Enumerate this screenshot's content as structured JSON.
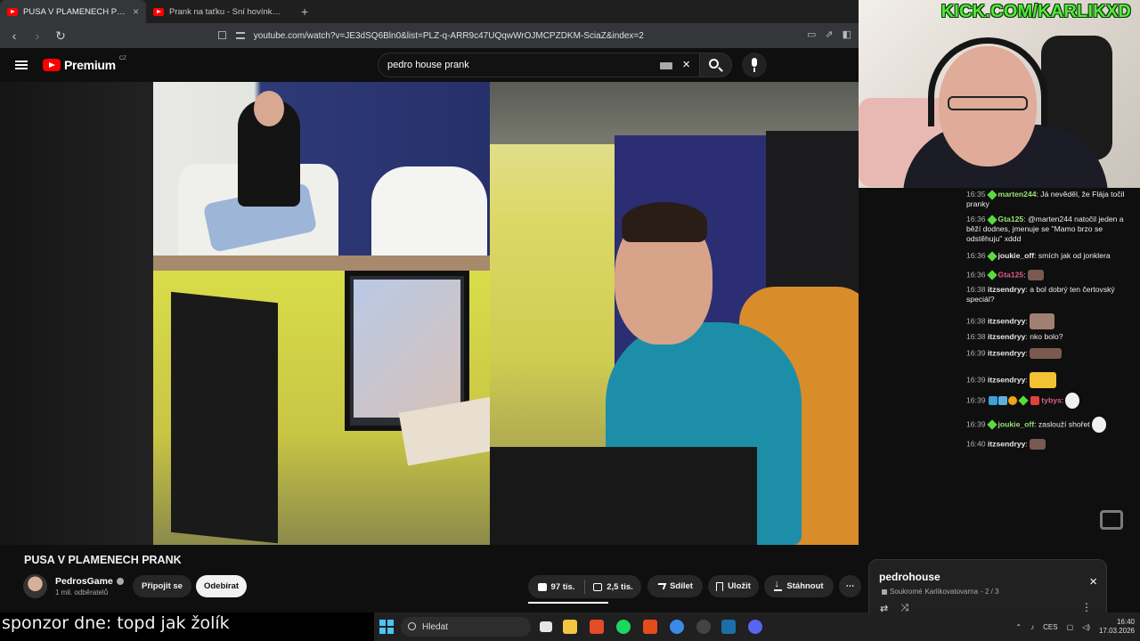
{
  "browser": {
    "tabs": [
      {
        "label": "PUSA V PLAMENECH PRANK",
        "close": "×"
      },
      {
        "label": "Prank na taťku - Sní hovínko!! - YouT",
        "close": ""
      }
    ],
    "new_tab": "+",
    "url": "youtube.com/watch?v=JE3dSQ6Bln0&list=PLZ-q-ARR9c47UQqwWrOJMCPZDKM-SciaZ&index=2"
  },
  "youtube": {
    "logo": "Premium",
    "region": "CZ",
    "search_value": "pedro house prank",
    "clear": "×"
  },
  "stream": {
    "kick_url": "KICK.COM/KARLIKXD",
    "sponsor": "sponzor dne: topd jak žolík"
  },
  "chat": [
    {
      "time": "16:35",
      "nick": "marten244",
      "text": ": Já nevěděl, že Flája točil pranky"
    },
    {
      "time": "16:36",
      "nick": "Gta125",
      "text": ": @marten244 natočil jeden a běží dodnes, jmenuje se \"Mamo brzo se odstěhuju\" xddd"
    },
    {
      "time": "16:36",
      "nick": "joukie_off",
      "text": ": smích jak od jonklera"
    },
    {
      "time": "16:36",
      "nick": "Gta125",
      "text": ":"
    },
    {
      "time": "16:38",
      "nick": "itzsendryy",
      "text": ": a bol dobrý ten čertovský speciál?"
    },
    {
      "time": "16:38",
      "nick": "itzsendryy",
      "text": ":"
    },
    {
      "time": "16:38",
      "nick": "itzsendryy",
      "text": ": nko bolo?"
    },
    {
      "time": "16:39",
      "nick": "itzsendryy",
      "text": ":"
    },
    {
      "time": "16:39",
      "nick": "itzsendryy",
      "text": ":"
    },
    {
      "time": "16:39",
      "nick": "tybys",
      "text": ":"
    },
    {
      "time": "16:39",
      "nick": "joukie_off",
      "text": ": zaslouží shořet"
    },
    {
      "time": "16:40",
      "nick": "itzsendryy",
      "text": ":"
    }
  ],
  "video": {
    "title": "PUSA V PLAMENECH PRANK",
    "channel": "PedrosGame",
    "subscribers": "1 mil. odběratelů",
    "join": "Připojit se",
    "unsubscribe": "Odebírat",
    "likes": "97 tis.",
    "dislikes": "2,5 tis.",
    "share": "Sdílet",
    "save": "Uložit",
    "download": "Stáhnout",
    "more": "⋯"
  },
  "playlist": {
    "title": "pedrohouse",
    "privacy": "Soukromé",
    "owner": "Karlikovatovarna",
    "position": "- 2 / 3",
    "close": "×"
  },
  "taskbar": {
    "search_placeholder": "Hledat",
    "language": "CES",
    "time": "16:40",
    "date": "17.03.2026"
  },
  "colors": {
    "youtube_red": "#ff0000",
    "kick_green": "#55e63d",
    "chat_nick_green": "#9ae076",
    "windows_accent": "#4cc2ff"
  }
}
